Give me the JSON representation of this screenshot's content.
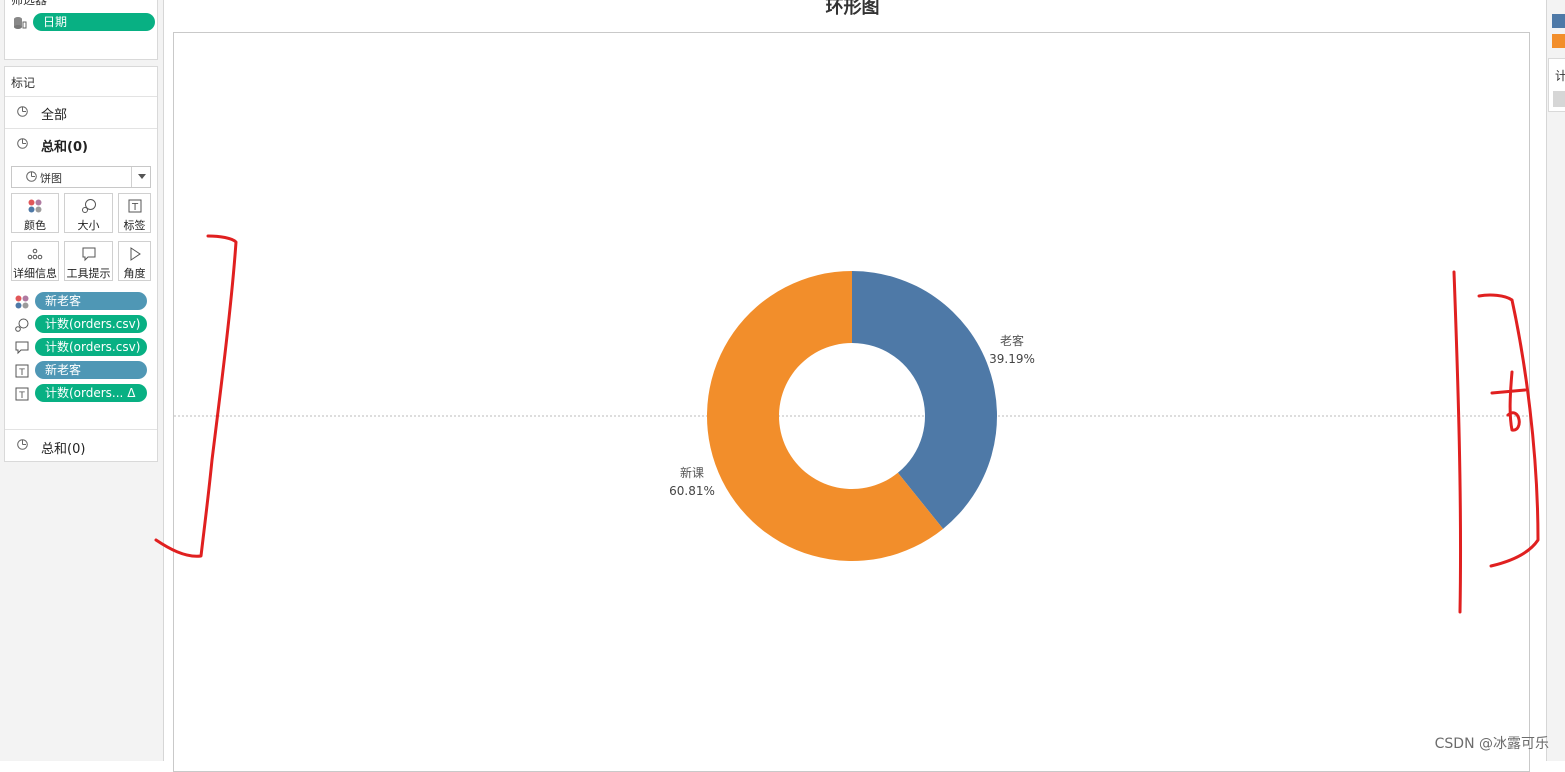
{
  "filters": {
    "header": "筛选器",
    "pill": "日期"
  },
  "marks": {
    "title": "标记",
    "rows": [
      "全部",
      "总和(0)"
    ],
    "mark_type": "饼图",
    "buttons": [
      "颜色",
      "大小",
      "标签",
      "详细信息",
      "工具提示",
      "角度"
    ],
    "shelf": [
      {
        "label": "新老客",
        "color": "#4f97b5",
        "icon": "color-icon"
      },
      {
        "label": "计数(orders.csv)",
        "color": "#08b083",
        "icon": "size-icon"
      },
      {
        "label": "计数(orders.csv)",
        "color": "#08b083",
        "icon": "tooltip-icon"
      },
      {
        "label": "新老客",
        "color": "#4f97b5",
        "icon": "label-icon"
      },
      {
        "label": "计数(orders... Δ",
        "color": "#08b083",
        "icon": "label-icon"
      }
    ],
    "footer": "总和(0)"
  },
  "legend_panel": {
    "label2": "计",
    "colors": [
      "#4e79a7",
      "#f28e2b"
    ]
  },
  "watermark": "CSDN @冰露可乐",
  "chart_data": {
    "type": "pie",
    "title": "环形图",
    "donut": true,
    "slices": [
      {
        "label": "老客",
        "value_label": "39.19%",
        "value": 39.19,
        "color": "#4e79a7"
      },
      {
        "label": "新课",
        "value_label": "60.81%",
        "value": 60.81,
        "color": "#f28e2b"
      }
    ],
    "reference_line": "dotted horizontal at center"
  }
}
